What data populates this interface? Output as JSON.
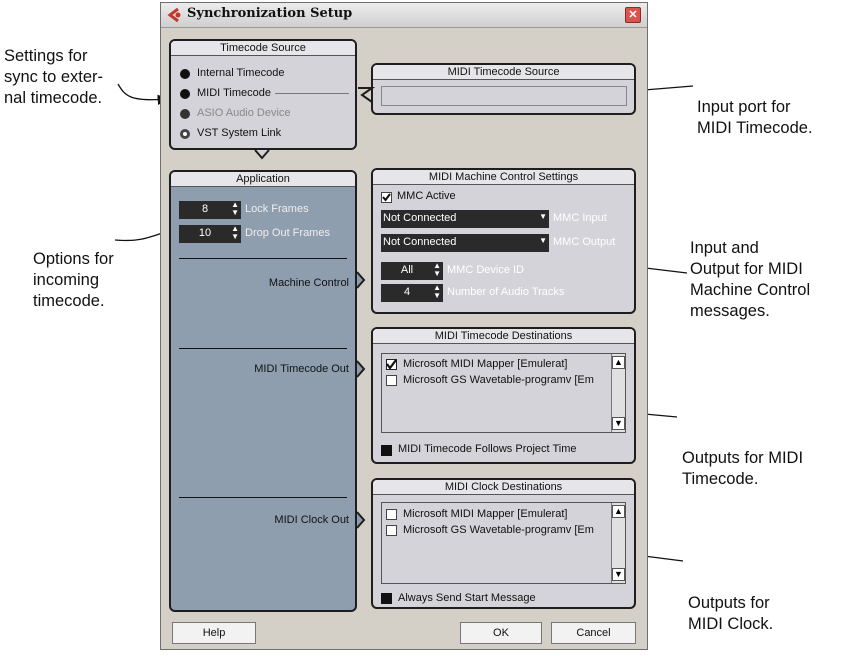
{
  "callouts": {
    "sync_external": [
      "Settings for",
      "sync to exter-",
      "nal timecode."
    ],
    "input_port": [
      "Input port for",
      "MIDI Timecode."
    ],
    "options_incoming": [
      "Options for",
      "incoming",
      "timecode."
    ],
    "mmc_io": [
      "Input and",
      "Output for MIDI",
      "Machine Control",
      "messages."
    ],
    "outputs_mtc": [
      "Outputs for MIDI",
      "Timecode."
    ],
    "outputs_clock": [
      "Outputs for",
      "MIDI Clock."
    ]
  },
  "window": {
    "title": "Synchronization Setup",
    "close": "✕"
  },
  "timecode_source": {
    "title": "Timecode Source",
    "options": [
      "Internal Timecode",
      "MIDI Timecode",
      "ASIO Audio Device",
      "VST System Link"
    ]
  },
  "mtc_source": {
    "title": "MIDI Timecode Source"
  },
  "application": {
    "title": "Application",
    "lock_frames_value": "8",
    "lock_frames_label": "Lock Frames",
    "dropout_value": "10",
    "dropout_label": "Drop Out Frames",
    "machine_control": "Machine Control",
    "mtc_out": "MIDI Timecode Out",
    "clock_out": "MIDI Clock Out"
  },
  "mmc": {
    "title": "MIDI Machine Control Settings",
    "active": "MMC Active",
    "input_value": "Not Connected",
    "input_label": "MMC Input",
    "output_value": "Not Connected",
    "output_label": "MMC Output",
    "device_value": "All",
    "device_label": "MMC Device ID",
    "tracks_value": "4",
    "tracks_label": "Number of Audio Tracks"
  },
  "mtc_dest": {
    "title": "MIDI Timecode Destinations",
    "items": [
      "Microsoft MIDI Mapper [Emulerat]",
      "Microsoft GS Wavetable-programv [Em"
    ],
    "follows": "MIDI Timecode Follows Project Time"
  },
  "clock_dest": {
    "title": "MIDI Clock Destinations",
    "items": [
      "Microsoft MIDI Mapper [Emulerat]",
      "Microsoft GS Wavetable-programv [Em"
    ],
    "start": "Always Send Start Message"
  },
  "buttons": {
    "help": "Help",
    "ok": "OK",
    "cancel": "Cancel"
  }
}
